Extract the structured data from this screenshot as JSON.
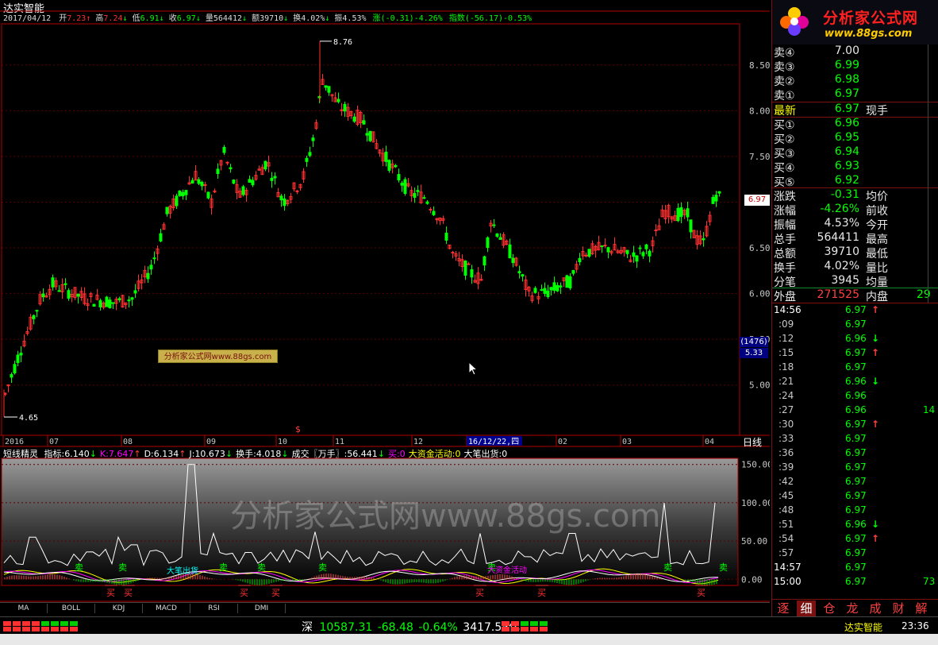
{
  "window": {
    "title": "达实智能"
  },
  "info_bar": {
    "date": "2017/04/12",
    "open_label": "开",
    "open": "7.23",
    "high_label": "高",
    "high": "7.24",
    "low_label": "低",
    "low": "6.91",
    "close_label": "收",
    "close": "6.97",
    "vol_label": "量",
    "vol": "564412",
    "amount_label": "额",
    "amount": "39710",
    "turnover_label": "换",
    "turnover": "4.02%",
    "amplitude_label": "振",
    "amplitude": "4.53%",
    "change_text": "涨(-0.31)-4.26%",
    "index_text": "指数(-56.17)-0.53%"
  },
  "colors": {
    "up": "#ff3030",
    "down": "#00ff00",
    "axis": "#b00000",
    "white": "#ffffff",
    "yellow": "#ffff00",
    "magenta": "#ff00ff",
    "cyan": "#00ffff"
  },
  "price_chart": {
    "y_min": 4.45,
    "y_max": 8.95,
    "y_ticks": [
      "8.50",
      "8.00",
      "7.50",
      "7.00",
      "6.50",
      "6.00",
      "5.50",
      "5.00"
    ],
    "y_tick_values": [
      8.5,
      8.0,
      7.5,
      7.0,
      6.5,
      6.0,
      5.5,
      5.0
    ],
    "high_label": "8.76",
    "low_label": "4.65",
    "current_price_tag": "6.97",
    "cursor_readout_top": "(1476)",
    "cursor_readout_bottom": "5.33",
    "x_labels": [
      "2016",
      "07",
      "08",
      "09",
      "10",
      "11",
      "12",
      "16/12/22,四",
      "02",
      "03",
      "04"
    ],
    "period_label": "日线",
    "marker_label": "$"
  },
  "watermark": {
    "badge": "分析家公式网www.88gs.com",
    "large": "分析家公式网www.88gs.com"
  },
  "indicator": {
    "name": "短线精灵",
    "fields": [
      {
        "label": "指标:",
        "value": "6.140",
        "arrow": "↓",
        "color": "#ffffff"
      },
      {
        "label": "K:",
        "value": "7.647",
        "arrow": "↑",
        "color": "#ff00ff"
      },
      {
        "label": "D:",
        "value": "6.134",
        "arrow": "↑",
        "color": "#ffffff"
      },
      {
        "label": "J:",
        "value": "10.673",
        "arrow": "↓",
        "color": "#ffffff"
      },
      {
        "label": "换手:",
        "value": "4.018",
        "arrow": "↓",
        "color": "#ffffff"
      },
      {
        "label": "成交〖万手〗:",
        "value": "56.441",
        "arrow": "↓",
        "color": "#ffffff"
      },
      {
        "label": "买:",
        "value": "0",
        "arrow": "",
        "color": "#ff00ff"
      },
      {
        "label": "大资金活动:",
        "value": "0",
        "arrow": "",
        "color": "#ffff00"
      },
      {
        "label": "大笔出货:",
        "value": "0",
        "arrow": "",
        "color": "#ffffff"
      }
    ],
    "y_ticks": [
      "150.00",
      "100.00",
      "50.00",
      "0.00"
    ],
    "y_tick_values": [
      150,
      100,
      50,
      0
    ],
    "sell_label": "卖",
    "buy_label": "买",
    "big_sell_label": "大笔出货",
    "big_fund_label": "大资金活动"
  },
  "tabs": [
    "MA",
    "BOLL",
    "KDJ",
    "MACD",
    "RSI",
    "DMI"
  ],
  "quote": {
    "sell_levels": [
      {
        "label": "卖④",
        "price": "7.00"
      },
      {
        "label": "卖③",
        "price": "6.99"
      },
      {
        "label": "卖②",
        "price": "6.98"
      },
      {
        "label": "卖①",
        "price": "6.97"
      }
    ],
    "latest": {
      "label": "最新",
      "price": "6.97",
      "extra": "现手"
    },
    "buy_levels": [
      {
        "label": "买①",
        "price": "6.96"
      },
      {
        "label": "买②",
        "price": "6.95"
      },
      {
        "label": "买③",
        "price": "6.94"
      },
      {
        "label": "买④",
        "price": "6.93"
      },
      {
        "label": "买⑤",
        "price": "6.92"
      }
    ],
    "stats": [
      {
        "label": "涨跌",
        "value": "-0.31",
        "right": "均价",
        "color": "#00ff00"
      },
      {
        "label": "涨幅",
        "value": "-4.26%",
        "right": "前收",
        "color": "#00ff00"
      },
      {
        "label": "振幅",
        "value": "4.53%",
        "right": "今开",
        "color": "#e8e8e8"
      },
      {
        "label": "总手",
        "value": "564411",
        "right": "最高",
        "color": "#e8e8e8"
      },
      {
        "label": "总额",
        "value": "39710",
        "right": "最低",
        "color": "#e8e8e8"
      },
      {
        "label": "换手",
        "value": "4.02%",
        "right": "量比",
        "color": "#e8e8e8"
      },
      {
        "label": "分笔",
        "value": "3945",
        "right": "均量",
        "color": "#e8e8e8"
      }
    ],
    "outer": {
      "label": "外盘",
      "value": "271525",
      "right": "内盘",
      "right_value": "29"
    }
  },
  "logo": {
    "text": "分析家公式网",
    "url": "www.88gs.com"
  },
  "ticks": [
    {
      "time": "14:56",
      "price": "6.97",
      "arrow": "↑",
      "vol": ""
    },
    {
      "time": ":09",
      "price": "6.97",
      "arrow": "",
      "vol": ""
    },
    {
      "time": ":12",
      "price": "6.96",
      "arrow": "↓",
      "vol": ""
    },
    {
      "time": ":15",
      "price": "6.97",
      "arrow": "↑",
      "vol": ""
    },
    {
      "time": ":18",
      "price": "6.97",
      "arrow": "",
      "vol": ""
    },
    {
      "time": ":21",
      "price": "6.96",
      "arrow": "↓",
      "vol": ""
    },
    {
      "time": ":24",
      "price": "6.96",
      "arrow": "",
      "vol": ""
    },
    {
      "time": ":27",
      "price": "6.96",
      "arrow": "",
      "vol": "14"
    },
    {
      "time": ":30",
      "price": "6.97",
      "arrow": "↑",
      "vol": ""
    },
    {
      "time": ":33",
      "price": "6.97",
      "arrow": "",
      "vol": ""
    },
    {
      "time": ":36",
      "price": "6.97",
      "arrow": "",
      "vol": ""
    },
    {
      "time": ":39",
      "price": "6.97",
      "arrow": "",
      "vol": ""
    },
    {
      "time": ":42",
      "price": "6.97",
      "arrow": "",
      "vol": ""
    },
    {
      "time": ":45",
      "price": "6.97",
      "arrow": "",
      "vol": ""
    },
    {
      "time": ":48",
      "price": "6.97",
      "arrow": "",
      "vol": ""
    },
    {
      "time": ":51",
      "price": "6.96",
      "arrow": "↓",
      "vol": ""
    },
    {
      "time": ":54",
      "price": "6.97",
      "arrow": "↑",
      "vol": ""
    },
    {
      "time": ":57",
      "price": "6.97",
      "arrow": "",
      "vol": ""
    },
    {
      "time": "14:57",
      "price": "6.97",
      "arrow": "",
      "vol": ""
    },
    {
      "time": "15:00",
      "price": "6.97",
      "arrow": "",
      "vol": "73"
    }
  ],
  "side_buttons": [
    "逐",
    "细",
    "仓",
    "龙",
    "成",
    "财",
    "解"
  ],
  "status_bar": {
    "market": "深",
    "index": "10587.31",
    "change": "-68.48",
    "pct": "-0.64%",
    "turnover": "3417.55亿",
    "stock_name": "达实智能",
    "clock": "23:36"
  }
}
